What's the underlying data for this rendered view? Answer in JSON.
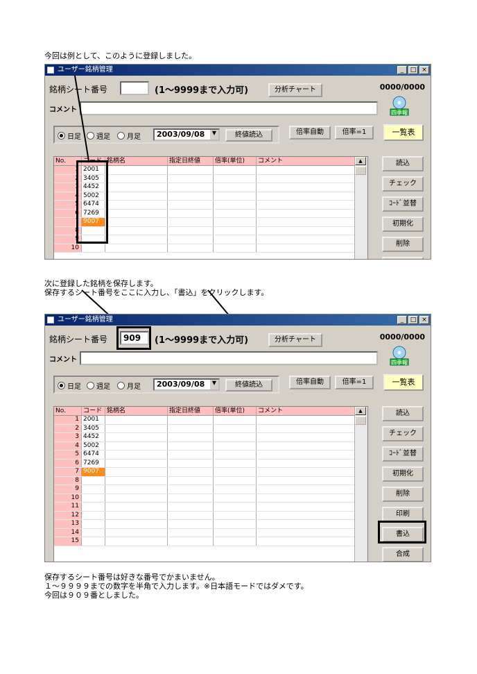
{
  "texts": {
    "intro": "今回は例として、このように登録しました。",
    "step2_line1": "次に登録した銘柄を保存します。",
    "step2_line2": "保存するシート番号をここに入力し、「書込」をクリックします。",
    "footer_line1": "保存するシート番号は好きな番号でかまいません。",
    "footer_line2": "１～９９９９までの数字を半角で入力します。※日本語モードではダメです。",
    "footer_line3": "今回は９０９番としました。"
  },
  "window": {
    "title": "ユーザー銘柄管理",
    "min": "_",
    "max": "□",
    "close": "×",
    "sheet_label": "銘柄シート番号",
    "range_label": "(1～9999まで入力可)",
    "chart_button": "分析チャート",
    "counter": "0000/0000",
    "comment_label": "コメント",
    "cd_label": "四季報",
    "radio_daily": "日足",
    "radio_weekly": "週足",
    "radio_monthly": "月足",
    "date_value": "2003/09/08",
    "read_close_button": "終値読込",
    "auto_ratio_button": "倍率自動",
    "ratio1_button": "倍率=1",
    "list_button": "一覧表",
    "columns": [
      "No.",
      "コード",
      "銘柄名",
      "指定日終値",
      "倍率(単位)",
      "コメント"
    ],
    "codes": [
      "2001",
      "3405",
      "4452",
      "5002",
      "6474",
      "7269",
      "9007"
    ],
    "side_buttons": [
      "読込",
      "チェック",
      "ｺｰﾄﾞ並替",
      "初期化",
      "削除",
      "印刷",
      "書込",
      "合成"
    ]
  },
  "window1_rows": [
    "1",
    "2",
    "3",
    "4",
    "5",
    "6",
    "7",
    "8",
    "9",
    "10"
  ],
  "window2_rows": [
    "1",
    "2",
    "3",
    "4",
    "5",
    "6",
    "7",
    "8",
    "9",
    "10",
    "11",
    "12",
    "13",
    "14",
    "15"
  ],
  "window2_sheet_value": "909",
  "colors": {
    "title_bar": "#0a246a",
    "header_pink": "#ffc0c0",
    "highlight_orange": "#ff8c1a"
  }
}
